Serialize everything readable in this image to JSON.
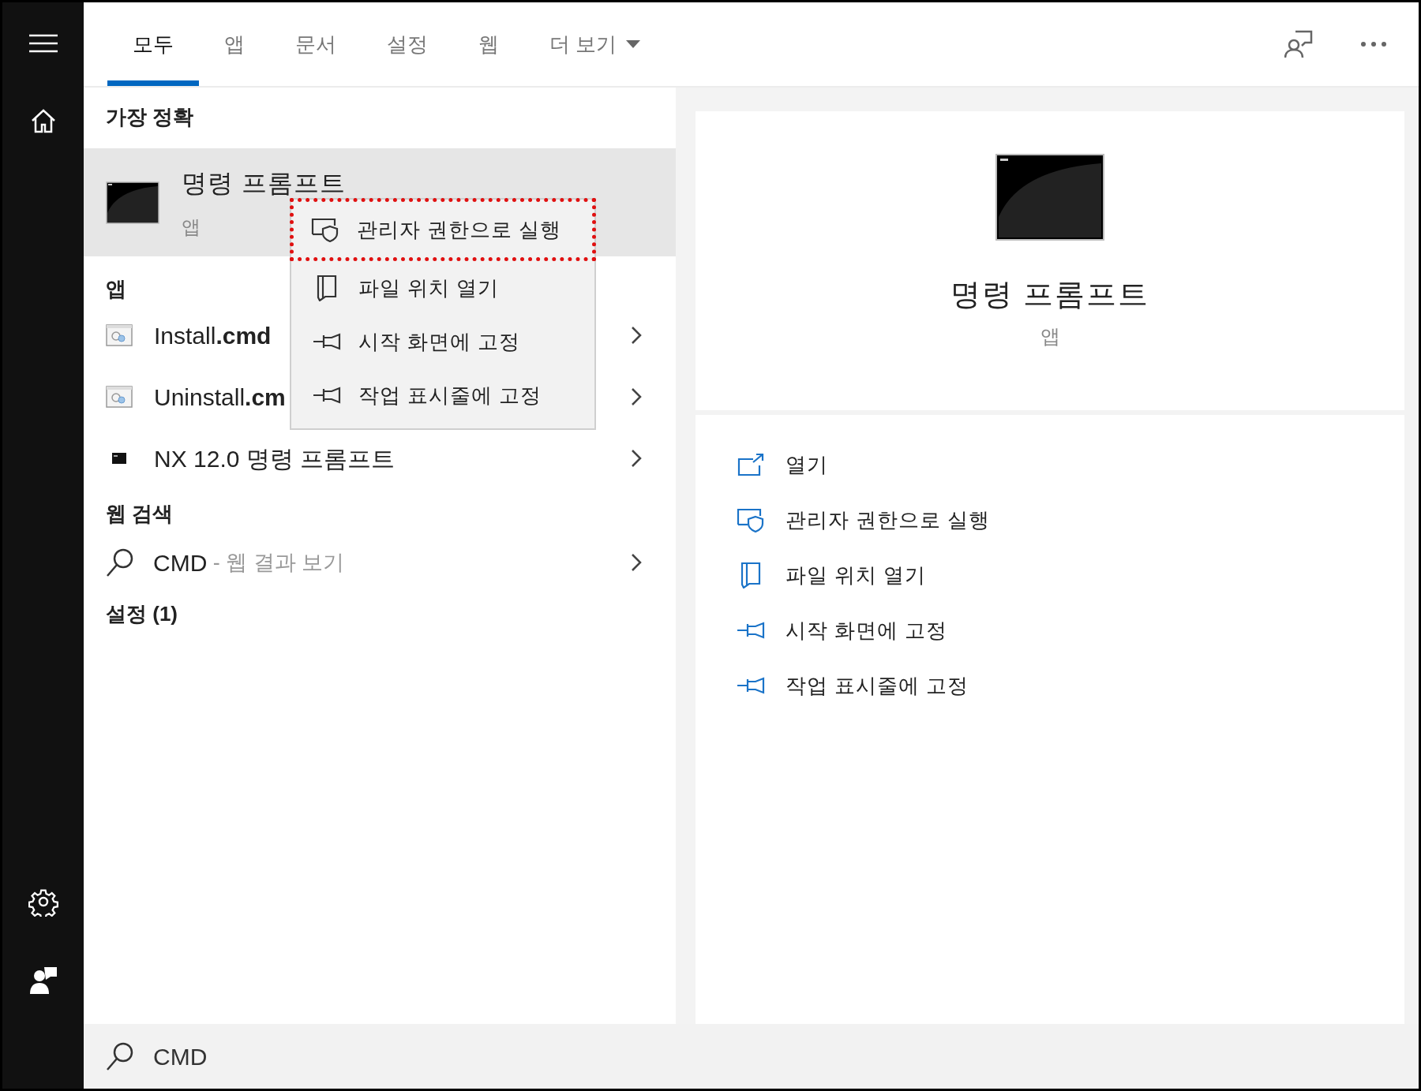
{
  "tabs": [
    {
      "label": "모두",
      "selected": true
    },
    {
      "label": "앱",
      "selected": false
    },
    {
      "label": "문서",
      "selected": false
    },
    {
      "label": "설정",
      "selected": false
    },
    {
      "label": "웹",
      "selected": false
    },
    {
      "label": "더 보기",
      "selected": false,
      "kind": "dropdown"
    }
  ],
  "best_match": {
    "heading": "가장 정확",
    "title": "명령 프롬프트",
    "subtitle": "앱",
    "selected": true
  },
  "context_menu": [
    {
      "label": "관리자 권한으로 실행",
      "kind": "shield",
      "highlighted": true
    },
    {
      "label": "파일 위치 열기",
      "kind": "folder",
      "highlighted": false
    },
    {
      "label": "시작 화면에 고정",
      "kind": "pin",
      "highlighted": false
    },
    {
      "label": "작업 표시줄에 고정",
      "kind": "pin",
      "highlighted": false
    }
  ],
  "apps": {
    "heading": "앱",
    "items": [
      {
        "label": "Install**.cmd**",
        "kind": "script"
      },
      {
        "label": "Uninstall**.cm**",
        "kind": "script"
      },
      {
        "label": "NX 12.0 명령 프롬프트",
        "kind": "console"
      }
    ]
  },
  "web_search": {
    "heading": "웹 검색",
    "query": "CMD",
    "suffix": " - 웹 결과 보기"
  },
  "settings": {
    "heading": "설정 (1)"
  },
  "preview": {
    "title": "명령 프롬프트",
    "subtitle": "앱",
    "actions": [
      {
        "label": "열기",
        "kind": "open"
      },
      {
        "label": "관리자 권한으로 실행",
        "kind": "shield"
      },
      {
        "label": "파일 위치 열기",
        "kind": "folder"
      },
      {
        "label": "시작 화면에 고정",
        "kind": "pin"
      },
      {
        "label": "작업 표시줄에 고정",
        "kind": "pin"
      }
    ]
  },
  "search_box": {
    "value": "CMD"
  }
}
